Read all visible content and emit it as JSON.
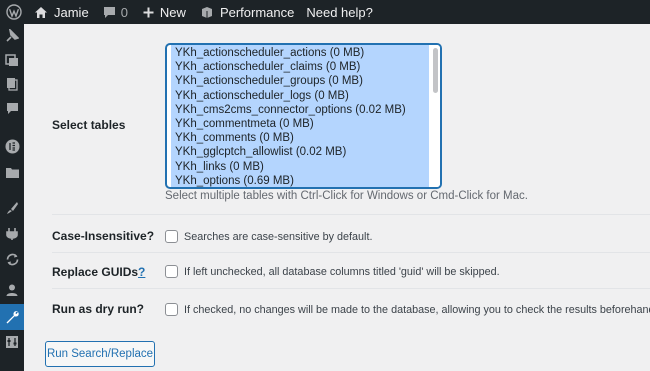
{
  "admin_bar": {
    "user": "Jamie",
    "comments_count": "0",
    "new_label": "New",
    "performance_label": "Performance",
    "help_label": "Need help?"
  },
  "form": {
    "select_tables_label": "Select tables",
    "tables": [
      "YKh_actionscheduler_actions (0 MB)",
      "YKh_actionscheduler_claims (0 MB)",
      "YKh_actionscheduler_groups (0 MB)",
      "YKh_actionscheduler_logs (0 MB)",
      "YKh_cms2cms_connector_options (0.02 MB)",
      "YKh_commentmeta (0 MB)",
      "YKh_comments (0 MB)",
      "YKh_gglcptch_allowlist (0.02 MB)",
      "YKh_links (0 MB)",
      "YKh_options (0.69 MB)"
    ],
    "select_hint": "Select multiple tables with Ctrl-Click for Windows or Cmd-Click for Mac.",
    "case_label": "Case-Insensitive?",
    "case_desc": "Searches are case-sensitive by default.",
    "guids_label": "Replace GUIDs",
    "guids_help": "?",
    "guids_desc": "If left unchecked, all database columns titled 'guid' will be skipped.",
    "dry_label": "Run as dry run?",
    "dry_desc": "If checked, no changes will be made to the database, allowing you to check the results beforehand.",
    "submit_label": "Run Search/Replace"
  }
}
